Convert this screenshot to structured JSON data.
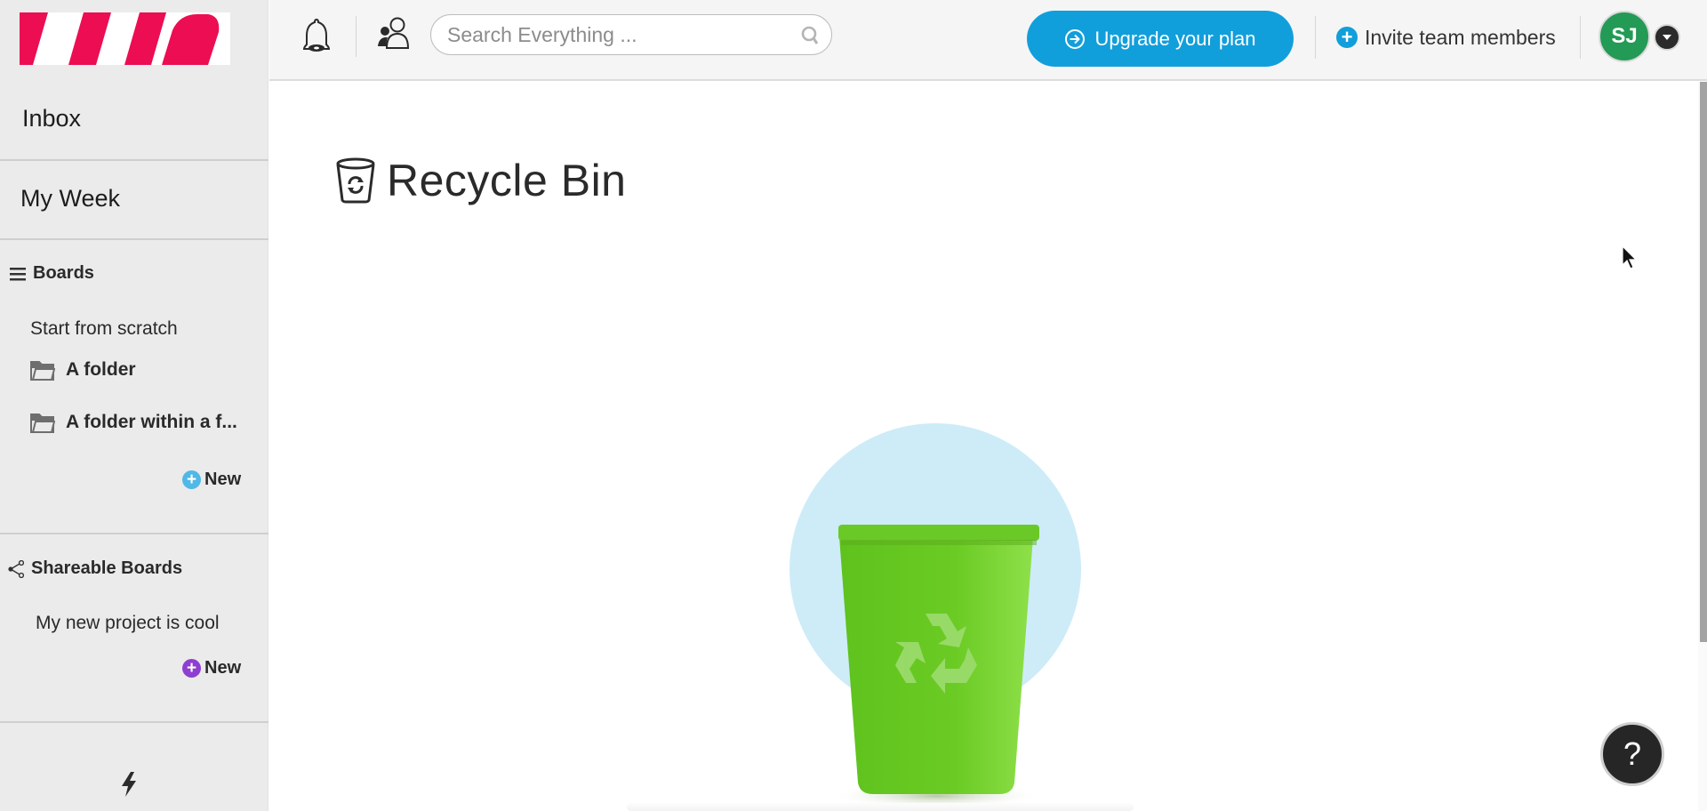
{
  "app": {
    "logo_name": "monday-style logo"
  },
  "sidebar": {
    "inbox_label": "Inbox",
    "my_week_label": "My Week",
    "boards_section": {
      "title": "Boards",
      "icon": "menu-icon",
      "items": [
        {
          "label": "Start from scratch",
          "type": "board"
        },
        {
          "label": "A folder",
          "type": "folder",
          "icon": "folder-icon"
        },
        {
          "label": "A folder within a f...",
          "type": "folder",
          "icon": "folder-icon"
        }
      ],
      "new_label": "New",
      "new_color": "#4fb8e6"
    },
    "shareable_section": {
      "title": "Shareable Boards",
      "icon": "share-icon",
      "items": [
        {
          "label": "My new project is cool"
        }
      ],
      "new_label": "New",
      "new_color": "#8e3fd1"
    },
    "bottom_icon": "bolt-icon"
  },
  "header": {
    "notifications_icon": "bell-icon",
    "people_icon": "team-icon",
    "search": {
      "placeholder": "Search Everything ...",
      "value": ""
    },
    "upgrade_label": "Upgrade your plan",
    "invite_label": "Invite team members",
    "avatar_initials": "SJ",
    "colors": {
      "accent": "#119fdb",
      "avatar": "#239a55"
    }
  },
  "main": {
    "title": "Recycle Bin",
    "title_icon": "recycle-bin-icon",
    "illustration": "green-recycle-bin",
    "help_label": "?"
  }
}
